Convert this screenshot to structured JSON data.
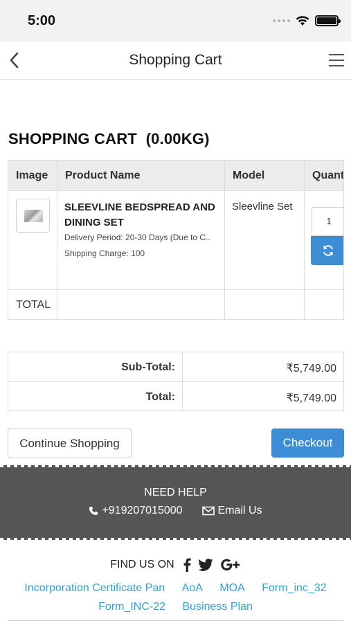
{
  "status_bar": {
    "time": "5:00"
  },
  "nav": {
    "title": "Shopping Cart",
    "back_icon": "chevron-left-icon",
    "menu_icon": "hamburger-icon"
  },
  "cart": {
    "heading": "SHOPPING CART  (0.00KG)",
    "columns": [
      "Image",
      "Product Name",
      "Model",
      "Quant"
    ],
    "item": {
      "name": "SLEEVLINE BEDSPREAD AND DINING SET",
      "delivery": "Delivery Period: 20-30 Days (Due to C..",
      "shipping": "Shipping Charge: 100",
      "model": "Sleevline Set",
      "quantity": "1"
    },
    "total_label": "TOTAL"
  },
  "totals": [
    {
      "label": "Sub-Total:",
      "value": "₹5,749.00"
    },
    {
      "label": "Total:",
      "value": "₹5,749.00"
    }
  ],
  "buttons": {
    "continue": "Continue Shopping",
    "checkout": "Checkout"
  },
  "help": {
    "title": "NEED HELP",
    "phone": "+919207015000",
    "email": "Email Us"
  },
  "footer": {
    "find_us": "FIND US ON",
    "links": [
      "Incorporation Certificate Pan",
      "AoA",
      "MOA",
      "Form_inc_32",
      "Form_INC-22",
      "Business Plan"
    ]
  },
  "colors": {
    "accent": "#3c8dd6",
    "link": "#2fa3d6",
    "help_bg": "#555555"
  }
}
